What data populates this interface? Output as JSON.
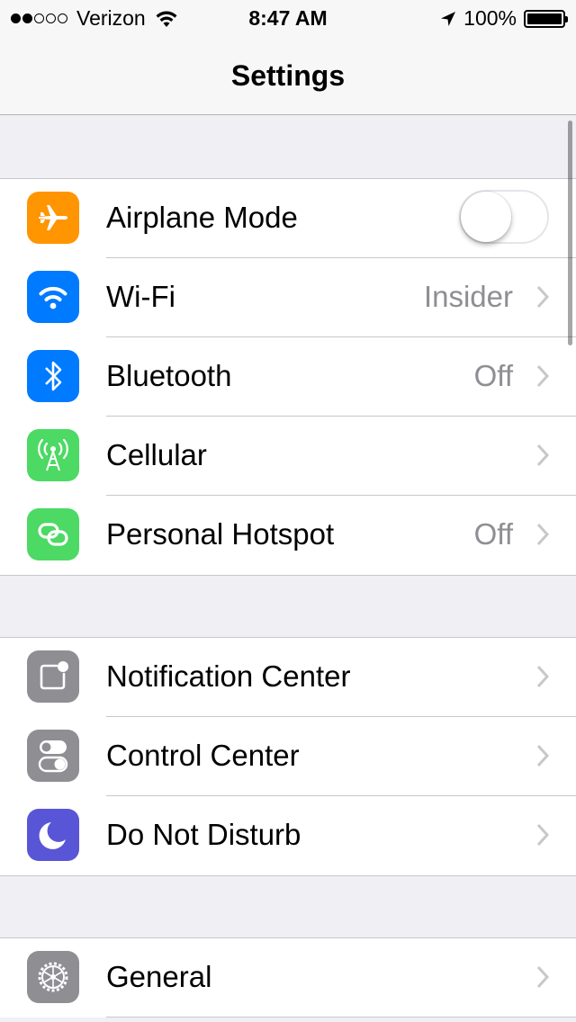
{
  "status": {
    "carrier": "Verizon",
    "signal_bars_filled": 2,
    "signal_bars_total": 5,
    "time": "8:47 AM",
    "battery_percent": "100%"
  },
  "nav": {
    "title": "Settings"
  },
  "groups": [
    {
      "rows": [
        {
          "label": "Airplane Mode",
          "icon": "airplane-icon",
          "color": "#ff9500",
          "toggle": false
        },
        {
          "label": "Wi-Fi",
          "icon": "wifi-icon",
          "color": "#007aff",
          "value": "Insider"
        },
        {
          "label": "Bluetooth",
          "icon": "bluetooth-icon",
          "color": "#007aff",
          "value": "Off"
        },
        {
          "label": "Cellular",
          "icon": "cellular-icon",
          "color": "#4cd964",
          "value": ""
        },
        {
          "label": "Personal Hotspot",
          "icon": "hotspot-icon",
          "color": "#4cd964",
          "value": "Off"
        }
      ]
    },
    {
      "rows": [
        {
          "label": "Notification Center",
          "icon": "notification-center-icon",
          "color": "#8e8e93"
        },
        {
          "label": "Control Center",
          "icon": "control-center-icon",
          "color": "#8e8e93"
        },
        {
          "label": "Do Not Disturb",
          "icon": "moon-icon",
          "color": "#5856d6"
        }
      ]
    },
    {
      "rows": [
        {
          "label": "General",
          "icon": "gear-icon",
          "color": "#8e8e93"
        }
      ]
    }
  ]
}
